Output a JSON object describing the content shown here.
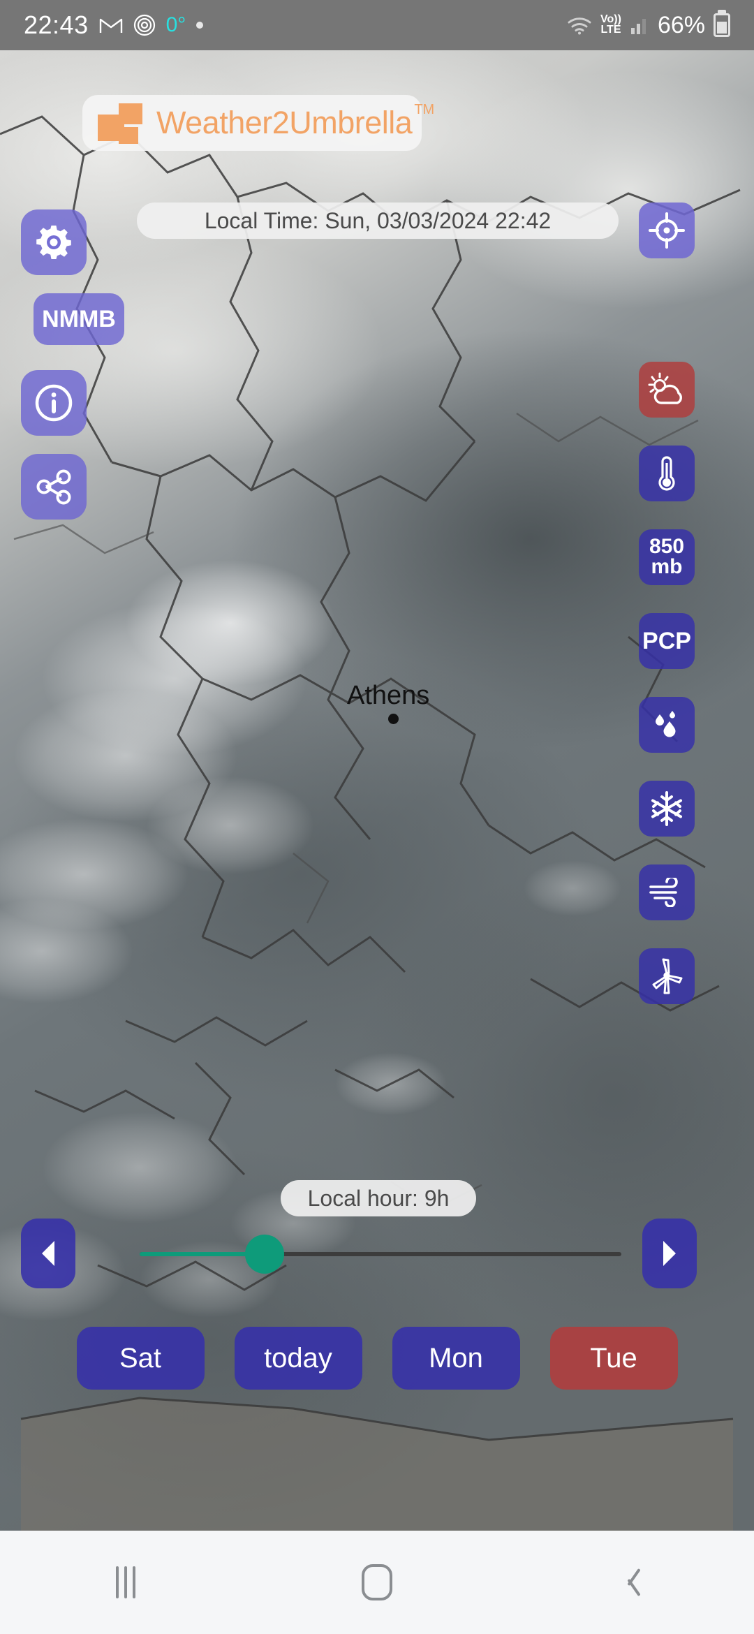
{
  "status_bar": {
    "clock": "22:43",
    "temperature": "0°",
    "battery_percent": "66%",
    "network_label_top": "Vo))",
    "network_label_bottom": "LTE",
    "icons": [
      "gmail-icon",
      "fingerprint-icon",
      "notification-dot",
      "wifi-icon",
      "volte-icon",
      "signal-bars-icon",
      "battery-icon"
    ]
  },
  "header": {
    "brand_name": "Weather2Umbrella",
    "trademark": "TM",
    "logo_icon": "stacked-squares-logo",
    "brand_color": "#f2a365",
    "local_time": "Local Time: Sun, 03/03/2024 22:42"
  },
  "left_controls": [
    {
      "name": "settings-button",
      "icon": "gear-icon",
      "label": ""
    },
    {
      "name": "model-button",
      "icon": "",
      "label": "NMMB"
    },
    {
      "name": "info-button",
      "icon": "info-circle-icon",
      "label": ""
    },
    {
      "name": "share-button",
      "icon": "share-nodes-icon",
      "label": ""
    }
  ],
  "right_controls": [
    {
      "name": "locate-button",
      "icon": "crosshair-icon",
      "label": "",
      "active": false,
      "style": "lilac"
    },
    {
      "name": "weather-layer-button",
      "icon": "sun-cloud-icon",
      "label": "",
      "active": true,
      "style": "active"
    },
    {
      "name": "temperature-layer-button",
      "icon": "thermometer-icon",
      "label": "",
      "active": false,
      "style": ""
    },
    {
      "name": "pressure-layer-button",
      "icon": "",
      "label": "850\nmb",
      "active": false,
      "style": ""
    },
    {
      "name": "precipitation-layer-button",
      "icon": "",
      "label": "PCP",
      "active": false,
      "style": ""
    },
    {
      "name": "humidity-layer-button",
      "icon": "water-drops-icon",
      "label": "",
      "active": false,
      "style": ""
    },
    {
      "name": "snow-layer-button",
      "icon": "snowflake-icon",
      "label": "",
      "active": false,
      "style": ""
    },
    {
      "name": "wind-layer-button",
      "icon": "wind-icon",
      "label": "",
      "active": false,
      "style": ""
    },
    {
      "name": "wind-energy-layer-button",
      "icon": "wind-turbine-icon",
      "label": "",
      "active": false,
      "style": ""
    }
  ],
  "map": {
    "city_marker_label": "Athens"
  },
  "timeline": {
    "hour_label": "Local hour: 9h",
    "prev_icon": "chevron-left-icon",
    "next_icon": "chevron-right-icon",
    "slider_percent": 26,
    "slider_accent": "#0e9b7a"
  },
  "days": [
    {
      "label": "Sat",
      "selected": false
    },
    {
      "label": "today",
      "selected": false
    },
    {
      "label": "Mon",
      "selected": false
    },
    {
      "label": "Tue",
      "selected": true
    }
  ],
  "nav_bar": {
    "recents": "recents-icon",
    "home": "home-icon",
    "back": "back-icon"
  }
}
